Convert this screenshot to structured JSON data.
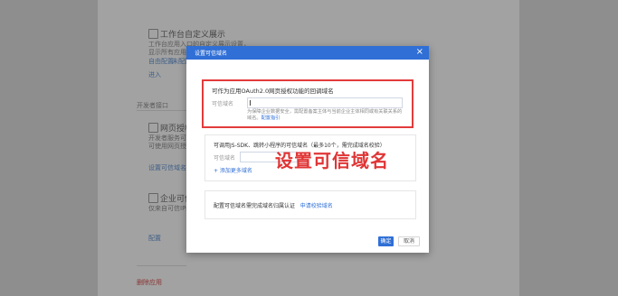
{
  "background": {
    "workbench_title": "工作台自定义展示",
    "workbench_desc_line1": "工作台应用入口的自定义展示设置，",
    "workbench_desc_line2": "显示所有应用的设置选项，",
    "workbench_link_a": "自由配置",
    "workbench_link_b": "未配置",
    "enter_link": "进入",
    "dev_info_label": "开发者接口",
    "oauth_title": "网页授权及",
    "oauth_desc_line1": "开发者服务可使用网页授权",
    "oauth_desc_line2": "可使用网页授权获取身份",
    "set_domain_link": "设置可信域名",
    "enterprise_title": "企业可信IP",
    "enterprise_desc": "仅来自可信IP的请求",
    "config_link": "配置",
    "delete_link": "删除应用"
  },
  "modal": {
    "title": "设置可信域名",
    "close_glyph": "×",
    "oauth_section_title": "可作为应用OAuth2.0网页授权功能的回调域名",
    "oauth_field_label": "可信域名",
    "oauth_field_value": "",
    "oauth_hint_text": "为保障企业数据安全，需配置备案主体与当前企业主体相同或有关联关系的域名。",
    "oauth_hint_link": "配置指引",
    "jssdk_section_title": "可调用JS-SDK、跳转小程序的可信域名（最多10个，需完成域名校验）",
    "jssdk_field_label": "可信域名",
    "add_more_link": "+ 添加更多域名",
    "verify_text": "配置可信域名需完成域名归属认证",
    "verify_link": "申请校验域名",
    "ok_button": "确定",
    "cancel_button": "取消"
  },
  "annotation": {
    "text": "设置可信域名"
  },
  "colors": {
    "primary": "#2f6fd6",
    "highlight_red": "#e33b3b"
  }
}
